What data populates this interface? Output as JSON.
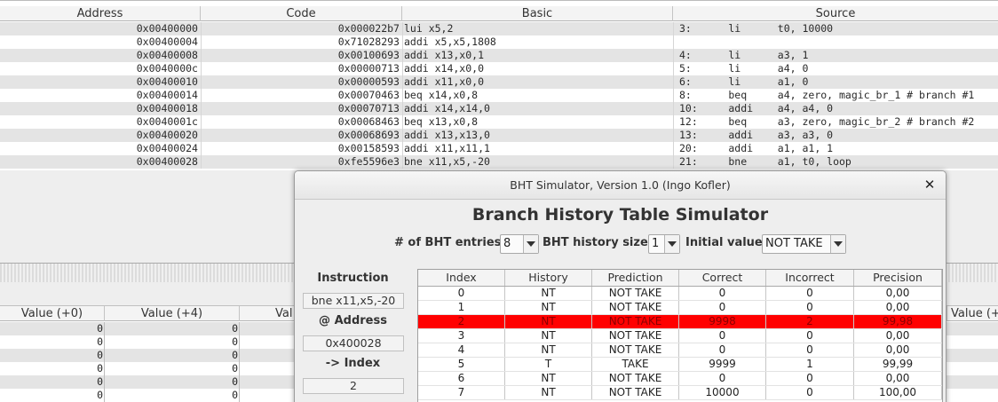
{
  "code_table": {
    "headers": [
      "Address",
      "Code",
      "Basic",
      "Source"
    ],
    "rows": [
      {
        "address": "0x00400000",
        "code": "0x000022b7",
        "basic": "lui x5,2",
        "source": "3:      li      t0, 10000"
      },
      {
        "address": "0x00400004",
        "code": "0x71028293",
        "basic": "addi x5,x5,1808",
        "source": ""
      },
      {
        "address": "0x00400008",
        "code": "0x00100693",
        "basic": "addi x13,x0,1",
        "source": "4:      li      a3, 1"
      },
      {
        "address": "0x0040000c",
        "code": "0x00000713",
        "basic": "addi x14,x0,0",
        "source": "5:      li      a4, 0"
      },
      {
        "address": "0x00400010",
        "code": "0x00000593",
        "basic": "addi x11,x0,0",
        "source": "6:      li      a1, 0"
      },
      {
        "address": "0x00400014",
        "code": "0x00070463",
        "basic": "beq x14,x0,8",
        "source": "8:      beq     a4, zero, magic_br_1 # branch #1"
      },
      {
        "address": "0x00400018",
        "code": "0x00070713",
        "basic": "addi x14,x14,0",
        "source": "10:     addi    a4, a4, 0"
      },
      {
        "address": "0x0040001c",
        "code": "0x00068463",
        "basic": "beq x13,x0,8",
        "source": "12:     beq     a3, zero, magic_br_2 # branch #2"
      },
      {
        "address": "0x00400020",
        "code": "0x00068693",
        "basic": "addi x13,x13,0",
        "source": "13:     addi    a3, a3, 0"
      },
      {
        "address": "0x00400024",
        "code": "0x00158593",
        "basic": "addi x11,x11,1",
        "source": "20:     addi    a1, a1, 1"
      },
      {
        "address": "0x00400028",
        "code": "0xfe5596e3",
        "basic": "bne x11,x5,-20",
        "source": "21:     bne     a1, t0, loop"
      }
    ]
  },
  "data_table": {
    "headers": [
      "Value (+0)",
      "Value (+4)",
      "Val",
      "Value (+"
    ],
    "rows": [
      [
        "0",
        "0"
      ],
      [
        "0",
        "0"
      ],
      [
        "0",
        "0"
      ],
      [
        "0",
        "0"
      ],
      [
        "0",
        "0"
      ],
      [
        "0",
        "0"
      ]
    ]
  },
  "dialog": {
    "title": "BHT Simulator, Version 1.0 (Ingo Kofler)",
    "close_glyph": "✕",
    "heading": "Branch History Table Simulator",
    "entries_label": "# of BHT entries",
    "entries_value": "8",
    "history_label": "BHT history size",
    "history_value": "1",
    "initial_label": "Initial value",
    "initial_value": "NOT TAKE",
    "instruction_label": "Instruction",
    "instruction_value": "bne x11,x5,-20",
    "address_label": "@ Address",
    "address_value": "0x400028",
    "index_label": "-> Index",
    "index_value": "2",
    "highlight_color": "#ff0000",
    "bht_headers": [
      "Index",
      "History",
      "Prediction",
      "Correct",
      "Incorrect",
      "Precision"
    ],
    "bht_rows": [
      {
        "index": "0",
        "history": "NT",
        "prediction": "NOT TAKE",
        "correct": "0",
        "incorrect": "0",
        "precision": "0,00",
        "active": false
      },
      {
        "index": "1",
        "history": "NT",
        "prediction": "NOT TAKE",
        "correct": "0",
        "incorrect": "0",
        "precision": "0,00",
        "active": false
      },
      {
        "index": "2",
        "history": "NT",
        "prediction": "NOT TAKE",
        "correct": "9998",
        "incorrect": "2",
        "precision": "99,98",
        "active": true
      },
      {
        "index": "3",
        "history": "NT",
        "prediction": "NOT TAKE",
        "correct": "0",
        "incorrect": "0",
        "precision": "0,00",
        "active": false
      },
      {
        "index": "4",
        "history": "NT",
        "prediction": "NOT TAKE",
        "correct": "0",
        "incorrect": "0",
        "precision": "0,00",
        "active": false
      },
      {
        "index": "5",
        "history": "T",
        "prediction": "TAKE",
        "correct": "9999",
        "incorrect": "1",
        "precision": "99,99",
        "active": false
      },
      {
        "index": "6",
        "history": "NT",
        "prediction": "NOT TAKE",
        "correct": "0",
        "incorrect": "0",
        "precision": "0,00",
        "active": false
      },
      {
        "index": "7",
        "history": "NT",
        "prediction": "NOT TAKE",
        "correct": "10000",
        "incorrect": "0",
        "precision": "100,00",
        "active": false
      }
    ]
  }
}
